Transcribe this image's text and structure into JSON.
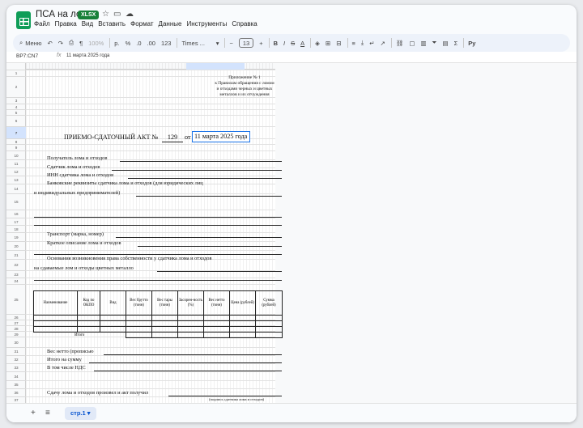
{
  "app": {
    "title": "ПСА на лом",
    "badge": "XLSX"
  },
  "menu": [
    "Файл",
    "Правка",
    "Вид",
    "Вставить",
    "Формат",
    "Данные",
    "Инструменты",
    "Справка"
  ],
  "toolbar": {
    "search": "Меню",
    "zoom": "100%",
    "currency": "р.",
    "percent": "%",
    "dec_minus": ".0",
    "dec_plus": ".00",
    "number_format": "123",
    "font": "Times ...",
    "font_size": "13",
    "bold": "B",
    "italic": "I",
    "strike": "S",
    "text_color": "A",
    "sigma": "Σ",
    "pu": "Pу"
  },
  "formula": {
    "namebox": "BP7:CN7",
    "fx": "fx",
    "value": "11 марта 2025 года"
  },
  "rows": [
    "1",
    "2",
    "3",
    "4",
    "5",
    "6",
    "7",
    "8",
    "9",
    "10",
    "11",
    "12",
    "13",
    "14",
    "15",
    "16",
    "17",
    "18",
    "19",
    "20",
    "21",
    "22",
    "23",
    "24",
    "25",
    "26",
    "27",
    "28",
    "29",
    "30",
    "31",
    "32",
    "33",
    "34",
    "35",
    "36",
    "37"
  ],
  "doc": {
    "appendix": [
      "Приложение № 1",
      "к Правилам обращения с ломом",
      "и отходами черных и цветных",
      "металлов и их отчуждения"
    ],
    "act_title": "ПРИЕМО-СДАТОЧНЫЙ АКТ №",
    "act_number": "129",
    "act_from": "от",
    "act_date": "11 марта 2025 года",
    "lines": {
      "receiver": "Получатель лома и отходов",
      "supplier": "Сдатчик лома и отходов",
      "inn": "ИНН сдатчика лома и отходов",
      "bank1": "Банковские реквизиты сдатчика лома и отходов (для юридических лиц",
      "bank2": "и индивидуальных предпринимателей)",
      "transport": "Транспорт (марка, номер)",
      "description": "Краткое описание лома и отходов",
      "basis1": "Основания возникновения права собственности у сдатчика лома и отходов",
      "basis2": "на сдаваемые лом и отходы цветных металло",
      "net_words": "Вес нетто (прописью",
      "total_sum": "Итого на сумму",
      "vat": "В том числе НДС",
      "handover": "Сдачу лома и отходов произвел и акт получил",
      "signature_hint": "(подпись сдатчика лома и отходов)"
    },
    "table": {
      "headers": [
        "Наименование",
        "Код по ОКПО",
        "Вид",
        "Вес брутто (тонн)",
        "Вес тары (тонн)",
        "Засорен-ность (%)",
        "Вес нетто (тонн)",
        "Цена (рублей)",
        "Сумма (рублей)"
      ],
      "total_label": "Итого"
    }
  },
  "sheet_tabs": {
    "active": "стр.1",
    "add": "+",
    "all": "≡"
  }
}
